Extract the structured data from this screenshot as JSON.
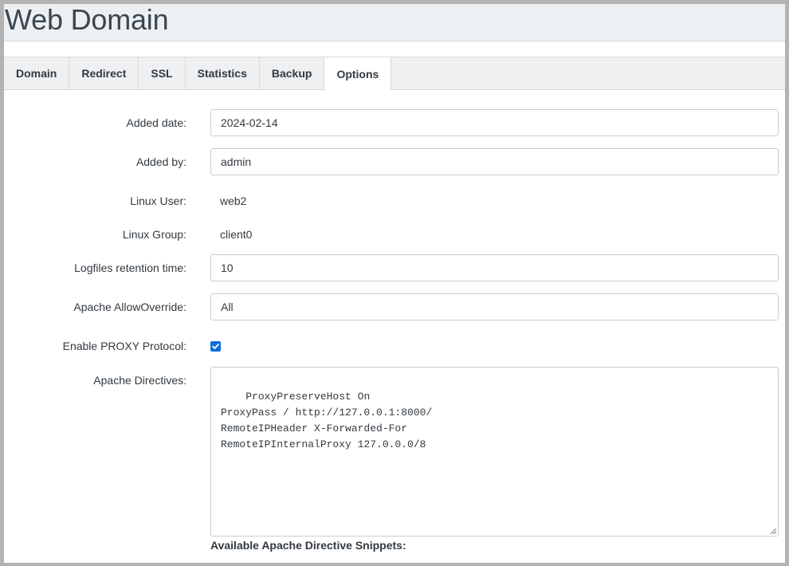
{
  "page": {
    "title": "Web Domain"
  },
  "tabs": [
    {
      "label": "Domain",
      "active": false
    },
    {
      "label": "Redirect",
      "active": false
    },
    {
      "label": "SSL",
      "active": false
    },
    {
      "label": "Statistics",
      "active": false
    },
    {
      "label": "Backup",
      "active": false
    },
    {
      "label": "Options",
      "active": true
    }
  ],
  "form": {
    "added_date": {
      "label": "Added date:",
      "value": "2024-02-14"
    },
    "added_by": {
      "label": "Added by:",
      "value": "admin"
    },
    "linux_user": {
      "label": "Linux User:",
      "value": "web2"
    },
    "linux_group": {
      "label": "Linux Group:",
      "value": "client0"
    },
    "logfiles_retention": {
      "label": "Logfiles retention time:",
      "value": "10"
    },
    "apache_allowoverride": {
      "label": "Apache AllowOverride:",
      "value": "All"
    },
    "enable_proxy_protocol": {
      "label": "Enable PROXY Protocol:",
      "checked": true
    },
    "apache_directives": {
      "label": "Apache Directives:",
      "value": "ProxyPreserveHost On\nProxyPass / http://127.0.0.1:8000/\nRemoteIPHeader X-Forwarded-For\nRemoteIPInternalProxy 127.0.0.0/8"
    },
    "snippets_title": "Available Apache Directive Snippets:"
  },
  "colors": {
    "checkbox_accent": "#0b6ede",
    "header_bg": "#edf0f2",
    "text": "#333a40"
  }
}
